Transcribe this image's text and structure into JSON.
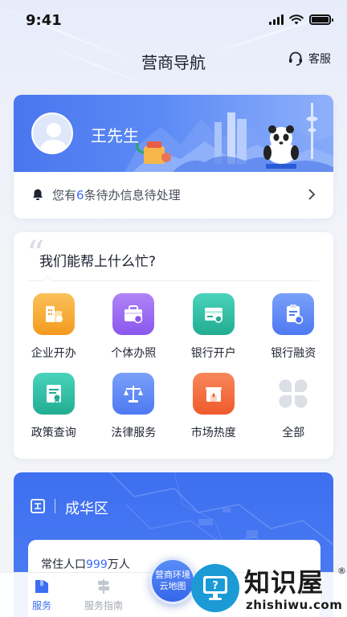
{
  "status_bar": {
    "time": "9:41"
  },
  "header": {
    "title": "营商导航",
    "service_label": "客服"
  },
  "user": {
    "name": "王先生"
  },
  "notice": {
    "prefix": "您有",
    "count": "6",
    "suffix": "条待办信息待处理"
  },
  "help": {
    "title": "我们能帮上什么忙?",
    "services": [
      {
        "label": "企业开办",
        "icon": "enterprise-icon",
        "color": "#f5a623"
      },
      {
        "label": "个体办照",
        "icon": "business-license-icon",
        "color": "#9b6bf2"
      },
      {
        "label": "银行开户",
        "icon": "bank-account-icon",
        "color": "#2fc1a6"
      },
      {
        "label": "银行融资",
        "icon": "bank-finance-icon",
        "color": "#5b86f5"
      },
      {
        "label": "政策查询",
        "icon": "policy-icon",
        "color": "#2fc1a6"
      },
      {
        "label": "法律服务",
        "icon": "law-scale-icon",
        "color": "#5b86f5"
      },
      {
        "label": "市场热度",
        "icon": "market-icon",
        "color": "#f26b3a"
      },
      {
        "label": "全部",
        "icon": "all-grid-icon",
        "color": "#d9dce2"
      }
    ]
  },
  "district": {
    "name": "成华区",
    "population_prefix": "常住人口",
    "population_value": "999",
    "population_unit": "万人"
  },
  "map_button": {
    "line1": "营商环境",
    "line2": "云地图"
  },
  "bottom_nav": [
    {
      "label": "服务",
      "icon": "service-icon",
      "active": true
    },
    {
      "label": "服务指南",
      "icon": "guide-icon",
      "active": false
    },
    {
      "label": "",
      "icon": "",
      "active": false
    },
    {
      "label": "",
      "icon": "",
      "active": false
    },
    {
      "label": "",
      "icon": "",
      "active": false
    }
  ],
  "watermark": {
    "title": "知识屋",
    "domain": "zhishiwu.com",
    "reg": "®"
  },
  "colors": {
    "accent": "#3b6ef5",
    "banner": "#4a76ee"
  }
}
